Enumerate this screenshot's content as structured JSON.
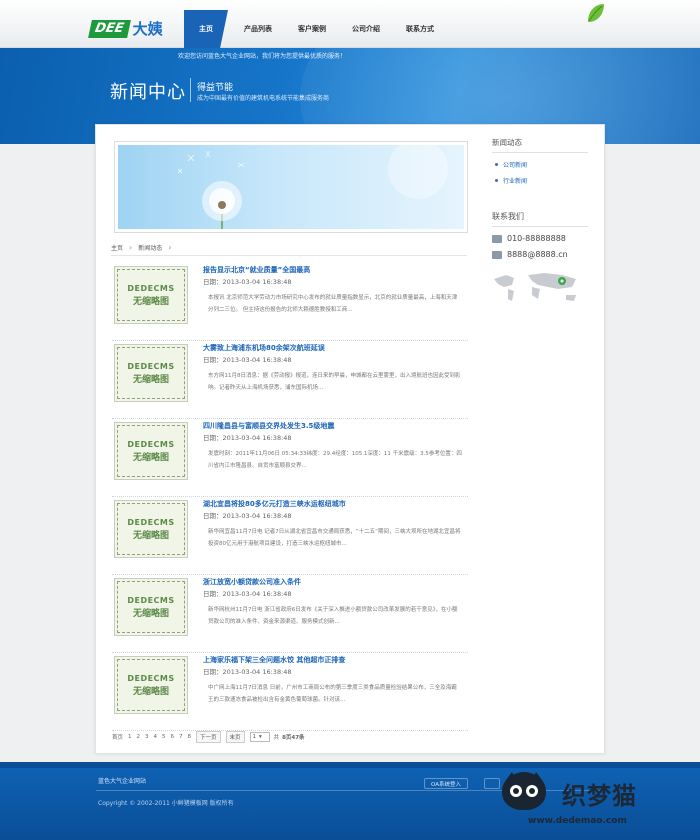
{
  "header": {
    "logo_en": "DEE",
    "logo_cn": "大姨",
    "nav": [
      "主页",
      "产品列表",
      "客户案例",
      "公司介绍",
      "联系方式"
    ],
    "welcome": "欢迎您访问蓝色大气企业网站，我们将为您提供最优质的服务！"
  },
  "banner": {
    "title": "新闻中心",
    "subtitle": "得益节能",
    "desc": "成为中国最有价值的建筑机电系统节能集成服务商"
  },
  "breadcrumb": [
    "主页",
    "新闻动态"
  ],
  "thumb": {
    "line1": "DEDECMS",
    "line2": "无缩略图"
  },
  "date_label": "日期：",
  "news": [
    {
      "title": "报告显示北京“就业质量”全国最高",
      "date": "2013-03-04 16:38:48",
      "summary": "本报讯 北京师范大学劳动力市场研究中心发布的就业质量指数显示，北京的就业质量最高，上海和天津分列二三位。 但主持这份报告的北师大赖德胜教授和工商..."
    },
    {
      "title": "大雾致上海浦东机场80余架次航班延误",
      "date": "2013-03-04 16:38:48",
      "summary": "东方网11月8日消息：据《劳动报》报道，连日来的早晨，申城都在云里雾里，出入境航班也因此受到影响。记者昨天从上海机场获悉，浦东国际机场..."
    },
    {
      "title": "四川隆昌县与富顺县交界处发生3.5级地震",
      "date": "2013-03-04 16:38:48",
      "summary": "发震时刻：2011年11月06日 05:34:33纬度：29.4经度：105.1深度：11 千米震级：3.5参考位置：四川省内江市隆昌县、自贡市富顺县交界..."
    },
    {
      "title": "湖北宜昌将投80多亿元打造三峡水运枢纽城市",
      "date": "2013-03-04 16:38:48",
      "summary": "新华网宜昌11月7日电 记者7日从湖北省宜昌市交通局获悉，“十二五”期间，三峡大坝所在地湖北宜昌将投资80亿元用于港航项目建设，打造三峡水运枢纽城市..."
    },
    {
      "title": "浙江放宽小额贷款公司准入条件",
      "date": "2013-03-04 16:38:48",
      "summary": "新华网杭州11月7日电 浙江省政府6日发布《关于深入推进小额贷款公司改革发展的若干意见》，在小额贷款公司的准入条件、资金来源渠道、服务模式创新..."
    },
    {
      "title": "上海家乐福下架三全问题水饺 其他超市正排查",
      "date": "2013-03-04 16:38:48",
      "summary": "中广网上海11月7日消息 日前，广州市工商局公布的第三季度三类食品质量检验结果公布，三全及海霸王的三款速冻食品被检出含有金黄色葡萄球菌。针对该..."
    }
  ],
  "pager": {
    "first": "首页",
    "current": "1",
    "pages": [
      "2",
      "3",
      "4",
      "5",
      "6",
      "7",
      "8"
    ],
    "next": "下一页",
    "last": "末页",
    "select_value": "1",
    "total_pages_label": "共",
    "total_pages": "8页",
    "total_items": "47条"
  },
  "sidebar": {
    "news_heading": "新闻动态",
    "links": [
      "公司新闻",
      "行业新闻"
    ],
    "contact_heading": "联系我们",
    "phone": "010-88888888",
    "email": "8888@8888.cn"
  },
  "footer": {
    "site_name": "蓝色大气企业网站",
    "copyright": "Copyright © 2002-2011 小鲜猪模板网 版权所有",
    "oa_button": "OA系统登入",
    "watermark_cn": "织梦猫",
    "watermark_url": "www.dedemao.com"
  },
  "colors": {
    "brand_blue": "#1a64b8",
    "logo_green": "#1e9a3c",
    "footer_blue": "#0f63b6"
  }
}
